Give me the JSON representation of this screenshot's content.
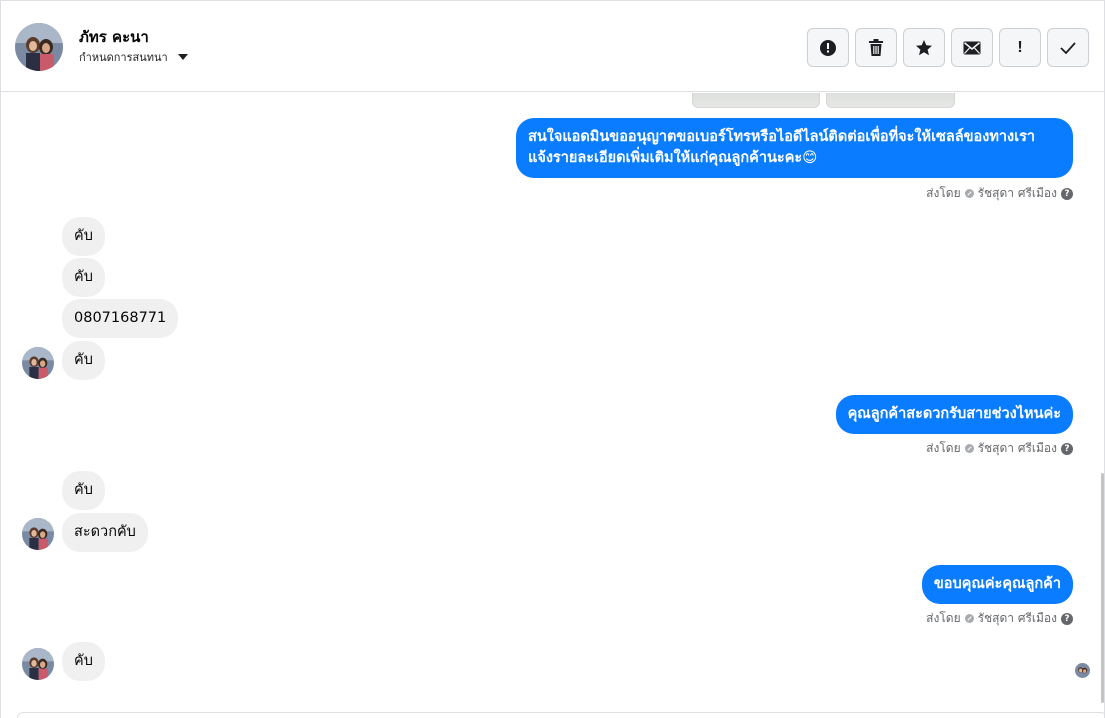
{
  "header": {
    "contact_name": "ภัทร คะนา",
    "assign_label": "กำหนดการสนทนา"
  },
  "messages": [
    {
      "direction": "out",
      "lines": [
        "สนใจแอดมินขออนุญาตขอเบอร์โทรหรือไอดีไลน์ติดต่อเพื่อที่จะให้เซลล์ของทางเรา",
        "แจ้งรายละเอียดเพิ่มเติมให้แก่คุณลูกค้านะคะ😊"
      ]
    },
    {
      "direction": "in",
      "text": "คับ"
    },
    {
      "direction": "in",
      "text": "คับ"
    },
    {
      "direction": "in",
      "text": "0807168771"
    },
    {
      "direction": "in",
      "text": "คับ"
    },
    {
      "direction": "out",
      "text": "คุณลูกค้าสะดวกรับสายช่วงไหนค่ะ"
    },
    {
      "direction": "in",
      "text": "คับ"
    },
    {
      "direction": "in",
      "text": "สะดวกคับ"
    },
    {
      "direction": "out",
      "text": "ขอบคุณค่ะคุณลูกค้า"
    },
    {
      "direction": "in",
      "text": "คับ"
    }
  ],
  "sent_meta": {
    "prefix": "ส่งโดย",
    "agent": "รัชสุดา ศรีเมือง"
  },
  "colors": {
    "outgoing_bubble": "#0a7cff",
    "incoming_bubble": "#f0f0f0",
    "meta_text": "#65676b"
  },
  "icons": {
    "toolbar": [
      "alert-circle-icon",
      "trash-icon",
      "star-icon",
      "envelope-icon",
      "exclamation-icon",
      "check-icon"
    ]
  }
}
